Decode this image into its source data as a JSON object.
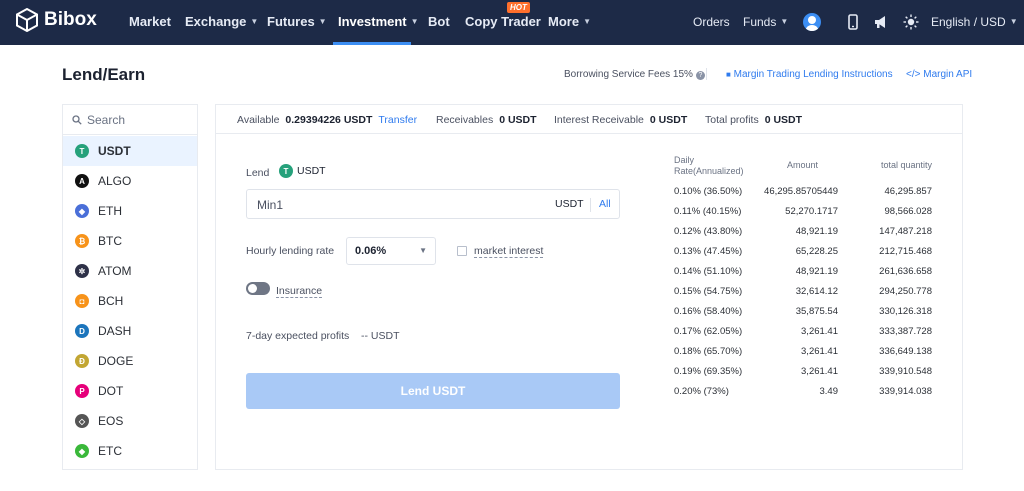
{
  "nav": {
    "brand": "Bibox",
    "items": [
      {
        "label": "Market",
        "caret": false
      },
      {
        "label": "Exchange",
        "caret": true
      },
      {
        "label": "Futures",
        "caret": true
      },
      {
        "label": "Investment",
        "caret": true,
        "active": true
      },
      {
        "label": "Bot",
        "caret": false
      },
      {
        "label": "Copy Trader",
        "caret": false,
        "badge": "HOT"
      },
      {
        "label": "More",
        "caret": true
      }
    ],
    "right": {
      "orders": "Orders",
      "funds": "Funds",
      "language": "English / USD"
    },
    "icons": [
      "avatar",
      "phone-icon",
      "megaphone-icon",
      "sun-icon"
    ],
    "colors": {
      "background": "#1d2a47",
      "accent": "#3c8ef3",
      "hot_badge": "#ff6f2c"
    }
  },
  "page": {
    "title": "Lend/Earn",
    "fees_text": "Borrowing Service Fees 15%",
    "instructions_link": "Margin Trading Lending Instructions",
    "api_link": "Margin API"
  },
  "sidebar": {
    "search_placeholder": "Search",
    "coins": [
      {
        "symbol": "USDT",
        "color": "#26a17b",
        "glyph": "T",
        "selected": true
      },
      {
        "symbol": "ALGO",
        "color": "#111111",
        "glyph": "A"
      },
      {
        "symbol": "ETH",
        "color": "#4a6fd8",
        "glyph": "◆"
      },
      {
        "symbol": "BTC",
        "color": "#f7931a",
        "glyph": "₿"
      },
      {
        "symbol": "ATOM",
        "color": "#2e3148",
        "glyph": "✲"
      },
      {
        "symbol": "BCH",
        "color": "#f7931a",
        "glyph": "◘"
      },
      {
        "symbol": "DASH",
        "color": "#1c75bc",
        "glyph": "D"
      },
      {
        "symbol": "DOGE",
        "color": "#c2a633",
        "glyph": "Ð"
      },
      {
        "symbol": "DOT",
        "color": "#e6007a",
        "glyph": "P"
      },
      {
        "symbol": "EOS",
        "color": "#555555",
        "glyph": "◇"
      },
      {
        "symbol": "ETC",
        "color": "#3ab83a",
        "glyph": "◆"
      }
    ]
  },
  "stats": {
    "available_label": "Available",
    "available_value": "0.29394226 USDT",
    "transfer_label": "Transfer",
    "receivables_label": "Receivables",
    "receivables_value": "0 USDT",
    "interest_label": "Interest Receivable",
    "interest_value": "0 USDT",
    "profits_label": "Total profits",
    "profits_value": "0 USDT"
  },
  "form": {
    "lend_label": "Lend",
    "coin": "USDT",
    "amount_placeholder": "Min1",
    "amount_unit": "USDT",
    "all_label": "All",
    "rate_label": "Hourly lending rate",
    "rate_value": "0.06%",
    "market_interest_label": "market interest",
    "market_interest_checked": false,
    "insurance_label": "Insurance",
    "insurance_on": false,
    "expected_label": "7-day expected profits",
    "expected_value": "-- USDT",
    "submit_label": "Lend USDT"
  },
  "rates": {
    "headers": {
      "rate": "Daily Rate(Annualized)",
      "amount": "Amount",
      "total": "total quantity"
    },
    "rows": [
      {
        "rate": "0.10% (36.50%)",
        "amount": "46,295.85705449",
        "total": "46,295.857"
      },
      {
        "rate": "0.11% (40.15%)",
        "amount": "52,270.1717",
        "total": "98,566.028"
      },
      {
        "rate": "0.12% (43.80%)",
        "amount": "48,921.19",
        "total": "147,487.218"
      },
      {
        "rate": "0.13% (47.45%)",
        "amount": "65,228.25",
        "total": "212,715.468"
      },
      {
        "rate": "0.14% (51.10%)",
        "amount": "48,921.19",
        "total": "261,636.658"
      },
      {
        "rate": "0.15% (54.75%)",
        "amount": "32,614.12",
        "total": "294,250.778"
      },
      {
        "rate": "0.16% (58.40%)",
        "amount": "35,875.54",
        "total": "330,126.318"
      },
      {
        "rate": "0.17% (62.05%)",
        "amount": "3,261.41",
        "total": "333,387.728"
      },
      {
        "rate": "0.18% (65.70%)",
        "amount": "3,261.41",
        "total": "336,649.138"
      },
      {
        "rate": "0.19% (69.35%)",
        "amount": "3,261.41",
        "total": "339,910.548"
      },
      {
        "rate": "0.20% (73%)",
        "amount": "3.49",
        "total": "339,914.038"
      }
    ]
  }
}
